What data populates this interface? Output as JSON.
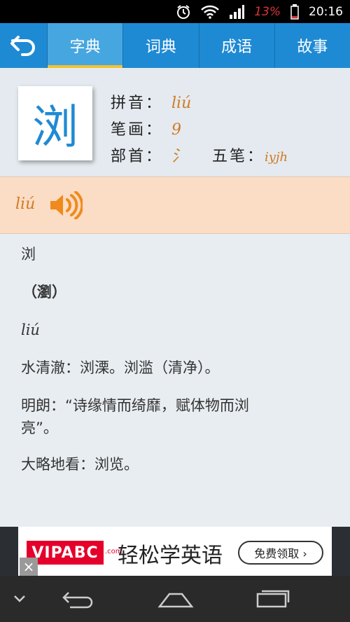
{
  "status_bar": {
    "icons": [
      "alarm-icon",
      "wifi-icon",
      "signal-icon",
      "battery-icon"
    ],
    "battery": "13%",
    "time": "20:16"
  },
  "nav": {
    "back_icon": "back-arrow-icon",
    "tabs": [
      {
        "label": "字典",
        "active": true
      },
      {
        "label": "词典",
        "active": false
      },
      {
        "label": "成语",
        "active": false
      },
      {
        "label": "故事",
        "active": false
      }
    ],
    "accent_color": "#1f8ad4",
    "active_indicator_color": "#f1c232"
  },
  "character": {
    "glyph": "浏",
    "pinyin_label": "拼音：",
    "pinyin": "liú",
    "strokes_label": "笔画：",
    "strokes": "9",
    "radical_label": "部首：",
    "radical": "氵",
    "wubi_label": "五笔：",
    "wubi": "iyjh"
  },
  "pronunciation": {
    "pinyin": "liú",
    "speaker_icon": "speaker-icon",
    "background_color": "#fbdcc4"
  },
  "definition": {
    "headword": "浏",
    "traditional": "（瀏）",
    "pinyin": "liú",
    "meanings": [
      "水清澈：浏溧。浏滥（清净）。",
      "明朗：“诗缘情而绮靡，赋体物而浏",
      "亮”。",
      "大略地看：浏览。"
    ]
  },
  "ad": {
    "brand": "VIPABC",
    "brand_suffix": ".com",
    "slogan": "轻松学英语",
    "cta": "免费领取 ›",
    "close": "×"
  },
  "system_nav": {
    "icons": [
      "chevron-down-icon",
      "back-icon",
      "home-icon",
      "recents-icon"
    ]
  }
}
